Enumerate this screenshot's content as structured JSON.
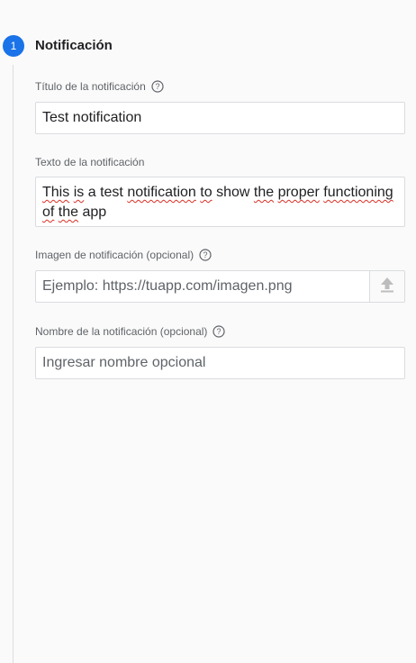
{
  "step": {
    "number": "1",
    "title": "Notificación"
  },
  "fields": {
    "title": {
      "label": "Título de la notificación",
      "value": "Test notification"
    },
    "text": {
      "label": "Texto de la notificación",
      "value_line1": "This is a test notification to show the proper functioning",
      "value_line2": "of the app",
      "value_words": [
        "This",
        "is",
        "a",
        "test",
        "notification",
        "to",
        "show",
        "the",
        "proper",
        "functioning"
      ],
      "value_words2": [
        "of",
        "the",
        "app"
      ]
    },
    "image": {
      "label": "Imagen de notificación (opcional)",
      "placeholder": "Ejemplo: https://tuapp.com/imagen.png",
      "button_icon": "upload-icon"
    },
    "name": {
      "label": "Nombre de la notificación (opcional)",
      "placeholder": "Ingresar nombre opcional"
    }
  },
  "icons": {
    "help": "help-circle-icon"
  },
  "colors": {
    "accent": "#1a73e8",
    "spellcheck": "#d93025"
  }
}
